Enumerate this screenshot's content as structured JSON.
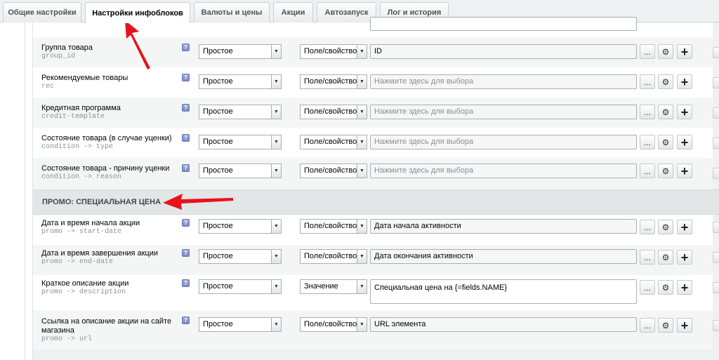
{
  "tabs": [
    {
      "label": "Общие настройки"
    },
    {
      "label": "Настройки инфоблоков"
    },
    {
      "label": "Валюты и цены"
    },
    {
      "label": "Акции"
    },
    {
      "label": "Автозапуск"
    },
    {
      "label": "Лог и история"
    }
  ],
  "help_glyph": "?",
  "buttons": {
    "more": "...",
    "add": "+"
  },
  "section": {
    "title": "ПРОМО: СПЕЦИАЛЬНАЯ ЦЕНА"
  },
  "rows": [
    {
      "name": "Группа товара",
      "code": "group_id",
      "type": "Простое",
      "source": "Поле/свойство",
      "value": "ID"
    },
    {
      "name": "Рекомендуемые товары",
      "code": "rec",
      "type": "Простое",
      "source": "Поле/свойство",
      "value": "Нажмите здесь для выбора"
    },
    {
      "name": "Кредитная программа",
      "code": "credit-template",
      "type": "Простое",
      "source": "Поле/свойство",
      "value": "Нажмите здесь для выбора"
    },
    {
      "name": "Состояние товара (в случае уценки)",
      "code": "condition -> type",
      "type": "Простое",
      "source": "Поле/свойство",
      "value": "Нажмите здесь для выбора"
    },
    {
      "name": "Состояние товара - причину уценки",
      "code": "condition -> reason",
      "type": "Простое",
      "source": "Поле/свойство",
      "value": "Нажмите здесь для выбора"
    },
    {
      "name": "Дата и время начала акции",
      "code": "promo -> start-date",
      "type": "Простое",
      "source": "Поле/свойство",
      "value": "Дата начала активности"
    },
    {
      "name": "Дата и время завершения акции",
      "code": "promo -> end-date",
      "type": "Простое",
      "source": "Поле/свойство",
      "value": "Дата окончания активности"
    },
    {
      "name": "Краткое описание акции",
      "code": "promo -> description",
      "type": "Простое",
      "source": "Значение",
      "value": "Специальная цена на {=fields.NAME}"
    },
    {
      "name": "Ссылка на описание акции на сайте",
      "name2": "магазина",
      "code": "promo -> url",
      "type": "Простое",
      "source": "Поле/свойство",
      "value": "URL элемента"
    }
  ],
  "colors": {
    "annotation_arrow": "#e8121b",
    "section_bg": "#e2e6e7",
    "panel_bg": "#eef1f1"
  }
}
